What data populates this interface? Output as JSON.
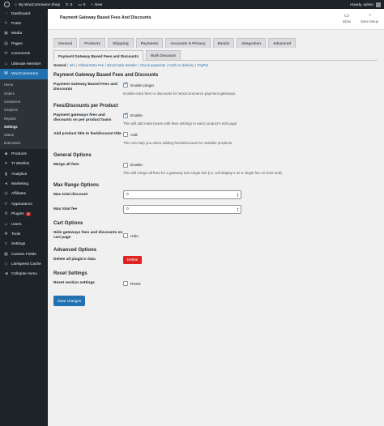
{
  "adminbar": {
    "site_name": "My WooCommerce Shop",
    "updates_count": "5",
    "comments_count": "0",
    "new_label": "New",
    "howdy": "Howdy, admin"
  },
  "sidebar": {
    "items": [
      {
        "label": "Dashboard",
        "icon": "dashboard-icon",
        "glyph": "◔"
      },
      {
        "label": "Posts",
        "icon": "pin-icon",
        "glyph": "✎"
      },
      {
        "label": "Media",
        "icon": "media-icon",
        "glyph": "▣"
      },
      {
        "label": "Pages",
        "icon": "page-icon",
        "glyph": "▤"
      },
      {
        "label": "Comments",
        "icon": "comment-icon",
        "glyph": "✉"
      },
      {
        "label": "Ultimate Member",
        "icon": "user-icon",
        "glyph": "☺"
      },
      {
        "label": "WooCommerce",
        "icon": "woo-icon",
        "glyph": "W"
      }
    ],
    "woo_submenu": [
      "Home",
      "Orders",
      "Customers",
      "Coupons",
      "Reports",
      "Settings",
      "Status",
      "Extensions"
    ],
    "items_after": [
      {
        "label": "Products",
        "icon": "products-icon",
        "glyph": "◆"
      },
      {
        "label": "TI Wishlist",
        "icon": "heart-icon",
        "glyph": "♥"
      },
      {
        "label": "Analytics",
        "icon": "analytics-icon",
        "glyph": "▮"
      },
      {
        "label": "Marketing",
        "icon": "megaphone-icon",
        "glyph": "◄"
      },
      {
        "label": "Affiliates",
        "icon": "affiliates-icon",
        "glyph": "◎"
      },
      {
        "label": "Appearance",
        "icon": "brush-icon",
        "glyph": "✐"
      },
      {
        "label": "Plugins",
        "icon": "plugin-icon",
        "glyph": "⚙",
        "badge": "3"
      },
      {
        "label": "Users",
        "icon": "users-icon",
        "glyph": "☺"
      },
      {
        "label": "Tools",
        "icon": "tools-icon",
        "glyph": "✚"
      },
      {
        "label": "Settings",
        "icon": "settings-icon",
        "glyph": "≡"
      },
      {
        "label": "Custom Fields",
        "icon": "fields-icon",
        "glyph": "▦"
      },
      {
        "label": "LiteSpeed Cache",
        "icon": "litespeed-icon",
        "glyph": "◇"
      },
      {
        "label": "Collapse menu",
        "icon": "collapse-icon",
        "glyph": "◀"
      }
    ]
  },
  "header": {
    "title": "Payment Gateway Based Fees And Discounts",
    "inbox_label": "Inbox",
    "store_setup_label": "Store Setup"
  },
  "tabs": [
    "General",
    "Products",
    "Shipping",
    "Payments",
    "Accounts & Privacy",
    "Emails",
    "Integration",
    "Advanced",
    "Payment Gateway Based Fees and Discounts",
    "Bulk Discount"
  ],
  "active_tab_index": 8,
  "subsections": [
    "General",
    "Info",
    "Global Extra Fee",
    "Direct bank transfer",
    "Check payments",
    "Cash on delivery",
    "PayPal"
  ],
  "sections": {
    "main_title": "Payment Gateway Based Fees and Discounts",
    "enable_label": "Payment Gateway Based Fees and Discounts",
    "enable_checkbox": "Enable plugin",
    "enable_desc": "Enable extra fees or discounts for WooCommerce payment gateways.",
    "per_product_title": "Fees/Discounts per Product",
    "per_product_label": "Payment gateways fees and discounts on per product basis",
    "per_product_checkbox": "Enable",
    "per_product_desc": "This will add meta boxes with fees settings to each product's edit page.",
    "add_title_label": "Add product title to fee/discount title",
    "add_title_checkbox": "Add",
    "add_title_desc": "This can help you when adding fees/discounts for variable products.",
    "general_title": "General Options",
    "merge_label": "Merge all fees",
    "merge_checkbox": "Enable",
    "merge_desc": "This will merge all fees for a gateway into single line (i.e. will display it as a single fee on front end).",
    "max_range_title": "Max Range Options",
    "max_discount_label": "Max total discount",
    "max_discount_value": "0",
    "max_fee_label": "Max total fee",
    "max_fee_value": "0",
    "cart_title": "Cart Options",
    "hide_label": "Hide gateways fees and discounts on cart page",
    "hide_checkbox": "Hide",
    "advanced_title": "Advanced Options",
    "delete_label": "Delete all plugin's data",
    "delete_button": "Delete",
    "reset_title": "Reset Settings",
    "reset_label": "Reset section settings",
    "reset_checkbox": "Reset",
    "save_button": "Save changes"
  },
  "states": {
    "enable_plugin": true,
    "per_product": true,
    "add_title": false,
    "merge": false,
    "hide": false,
    "reset": false
  },
  "colors": {
    "admin_dark": "#1d2327",
    "accent": "#2271b1",
    "danger": "#e02424"
  }
}
